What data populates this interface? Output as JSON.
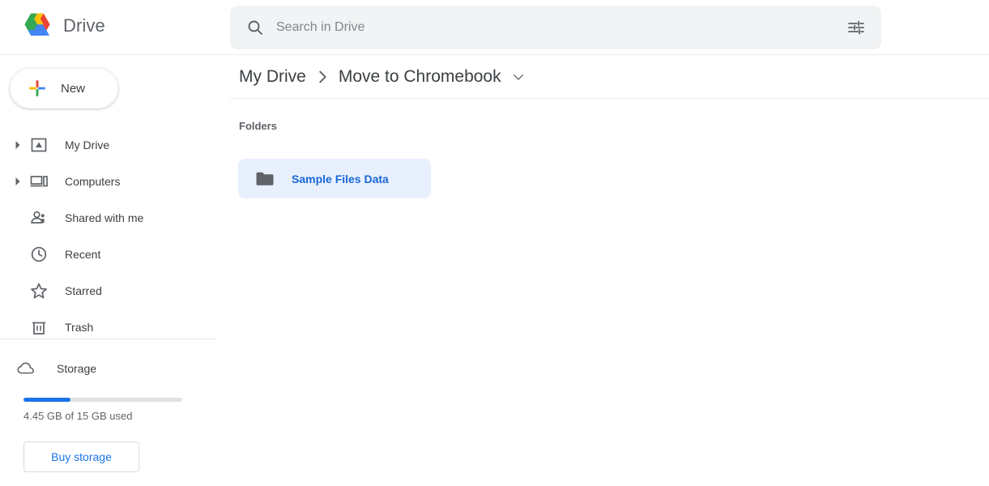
{
  "header": {
    "brand_name": "Drive",
    "logo_icon": "drive-logo",
    "search": {
      "placeholder": "Search in Drive",
      "value": "",
      "search_icon": "search-icon",
      "tune_icon": "tune-filter-icon"
    }
  },
  "sidebar": {
    "new_button": {
      "label": "New",
      "icon": "plus-icon"
    },
    "items": [
      {
        "label": "My Drive",
        "icon": "my-drive-icon",
        "expandable": true
      },
      {
        "label": "Computers",
        "icon": "computers-icon",
        "expandable": true
      },
      {
        "label": "Shared with me",
        "icon": "shared-with-me-icon",
        "expandable": false
      },
      {
        "label": "Recent",
        "icon": "clock-icon",
        "expandable": false
      },
      {
        "label": "Starred",
        "icon": "star-icon",
        "expandable": false
      },
      {
        "label": "Trash",
        "icon": "trash-icon",
        "expandable": false
      }
    ],
    "storage": {
      "label": "Storage",
      "icon": "cloud-icon",
      "used_text": "4.45 GB of 15 GB used",
      "percent_used": 29.7,
      "bar_color": "#1a73e8",
      "buy_button_label": "Buy storage"
    }
  },
  "main": {
    "breadcrumb": {
      "root": "My Drive",
      "separator_icon": "chevron-right-icon",
      "current": "Move to Chromebook",
      "caret_icon": "chevron-down-icon"
    },
    "section_label": "Folders",
    "folders": [
      {
        "name": "Sample Files Data",
        "icon": "folder-icon",
        "selected": true
      }
    ]
  },
  "colors": {
    "accent_blue": "#1a73e8",
    "folder_selected_bg": "#e8f0fe",
    "folder_label": "#1967d2",
    "search_bg": "#f1f3f4",
    "text_primary": "#3c4043",
    "text_secondary": "#5f6368"
  }
}
